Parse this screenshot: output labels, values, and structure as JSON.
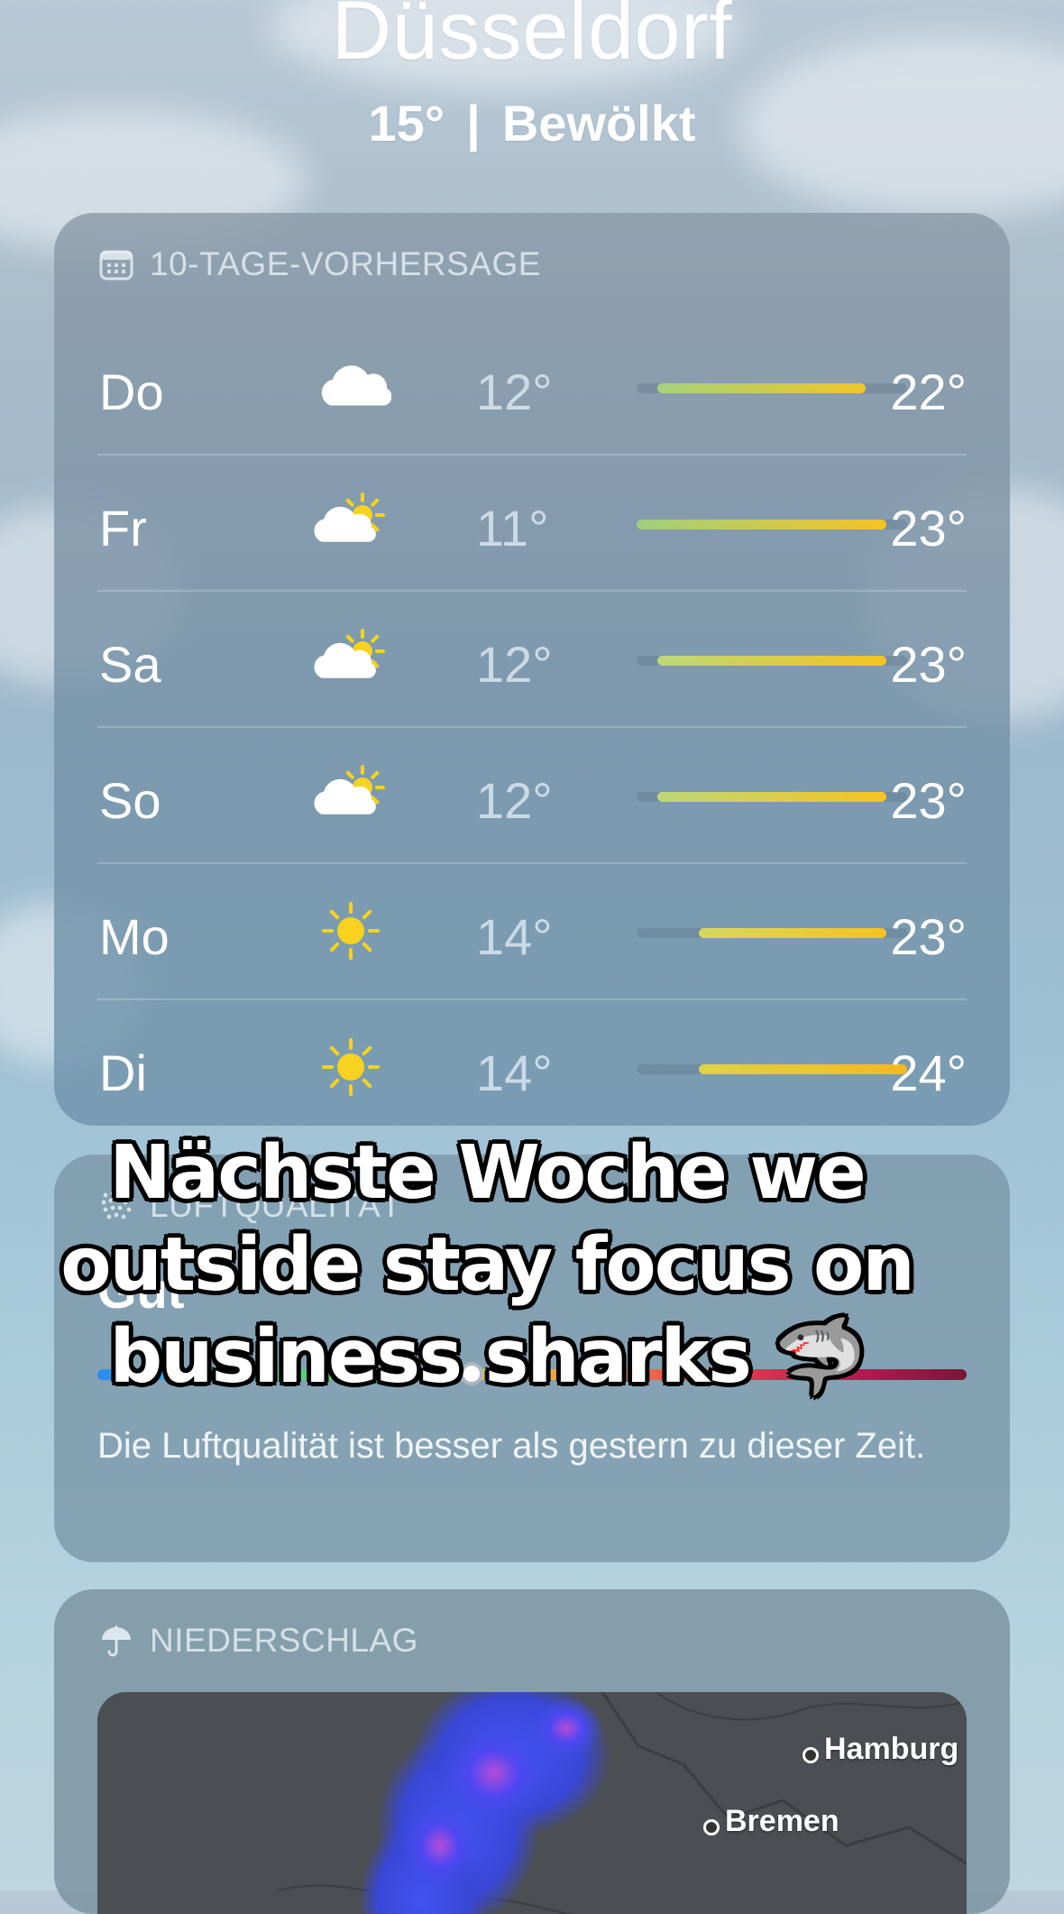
{
  "header": {
    "city": "Düsseldorf",
    "temperature": "15°",
    "separator": "|",
    "condition": "Bewölkt"
  },
  "forecast": {
    "title": "10-TAGE-VORHERSAGE",
    "icon": "calendar-icon",
    "range_min": 11,
    "range_max": 24,
    "days": [
      {
        "day": "Do",
        "icon": "cloud-icon",
        "low": "12°",
        "high": "22°",
        "low_value": 12,
        "high_value": 22,
        "gradient": [
          "#a6d27d",
          "#f0c62a"
        ]
      },
      {
        "day": "Fr",
        "icon": "partly-sunny-icon",
        "low": "11°",
        "high": "23°",
        "low_value": 11,
        "high_value": 23,
        "gradient": [
          "#9fd07f",
          "#f5c322"
        ]
      },
      {
        "day": "Sa",
        "icon": "partly-sunny-icon",
        "low": "12°",
        "high": "23°",
        "low_value": 12,
        "high_value": 23,
        "gradient": [
          "#bcd77a",
          "#f5c322"
        ]
      },
      {
        "day": "So",
        "icon": "partly-sunny-icon",
        "low": "12°",
        "high": "23°",
        "low_value": 12,
        "high_value": 23,
        "gradient": [
          "#bcd77a",
          "#f5c322"
        ]
      },
      {
        "day": "Mo",
        "icon": "sun-icon",
        "low": "14°",
        "high": "23°",
        "low_value": 14,
        "high_value": 23,
        "gradient": [
          "#d7d660",
          "#f5c322"
        ]
      },
      {
        "day": "Di",
        "icon": "sun-icon",
        "low": "14°",
        "high": "24°",
        "low_value": 14,
        "high_value": 24,
        "gradient": [
          "#e0d24a",
          "#f4b91e"
        ]
      }
    ]
  },
  "air_quality": {
    "title": "LUFTQUALITÄT",
    "icon": "air-quality-icon",
    "value": "Gut",
    "description": "Die Luftqualität ist besser als gestern zu dieser Zeit."
  },
  "precipitation": {
    "title": "NIEDERSCHLAG",
    "icon": "umbrella-icon",
    "map_labels": [
      "Hamburg",
      "Bremen"
    ]
  },
  "overlay": {
    "lines": [
      "Nächste Woche we",
      "outside stay focus on",
      "business sharks 🦈"
    ]
  },
  "colors": {
    "sun": "#f7d21e",
    "cloud": "#ffffff"
  }
}
